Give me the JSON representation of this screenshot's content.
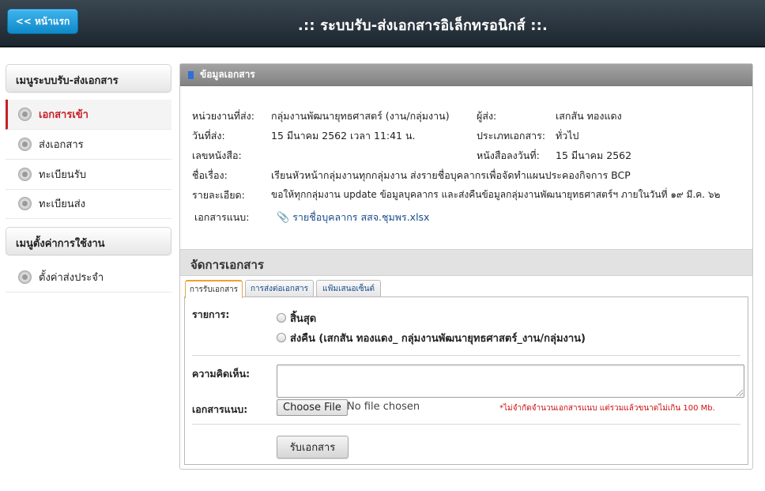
{
  "header": {
    "home_label": "<< หน้าแรก",
    "title": ".:: ระบบรับ-ส่งเอกสารอิเล็กทรอนิกส์ ::."
  },
  "sidebar": {
    "menu1_title": "เมนูระบบรับ-ส่งเอกสาร",
    "menu1_items": [
      {
        "label": "เอกสารเข้า",
        "active": true
      },
      {
        "label": "ส่งเอกสาร",
        "active": false
      },
      {
        "label": "ทะเบียนรับ",
        "active": false
      },
      {
        "label": "ทะเบียนส่ง",
        "active": false
      }
    ],
    "menu2_title": "เมนูตั้งค่าการใช้งาน",
    "menu2_items": [
      {
        "label": "ตั้งค่าส่งประจำ",
        "active": false
      }
    ]
  },
  "doc_info": {
    "section_title": "ข้อมูลเอกสาร",
    "sender_unit_label": "หน่วยงานที่ส่ง:",
    "sender_unit": "กลุ่มงานพัฒนายุทธศาสตร์ (งาน/กลุ่มงาน)",
    "sender_label": "ผู้ส่ง:",
    "sender": "เสกสัน ทองแดง",
    "sent_date_label": "วันที่ส่ง:",
    "sent_date": "15 มีนาคม 2562 เวลา 11:41 น.",
    "doc_type_label": "ประเภทเอกสาร:",
    "doc_type": "ทั่วไป",
    "doc_no_label": "เลขหนังสือ:",
    "doc_no": "",
    "doc_date_label": "หนังสือลงวันที่:",
    "doc_date": "15 มีนาคม 2562",
    "subject_label": "ชื่อเรื่อง:",
    "subject": "เรียนหัวหน้ากลุ่มงานทุกกลุ่มงาน ส่งรายชื่อบุคลากรเพื่อจัดทำแผนประคองกิจการ BCP",
    "detail_label": "รายละเอียด:",
    "detail": "ขอให้ทุกกลุ่มงาน update ข้อมูลบุคลากร และส่งคืนข้อมูลกลุ่มงานพัฒนายุทธศาสตร์ฯ ภายในวันที่ ๑๙ มี.ค. ๖๒",
    "attachment_label": "เอกสารแนบ:",
    "attachment": "รายชื่อบุคลากร สสจ.ชุมพร.xlsx"
  },
  "manage": {
    "title": "จัดการเอกสาร",
    "tabs": [
      {
        "label": "การรับเอกสาร",
        "active": true
      },
      {
        "label": "การส่งต่อเอกสาร",
        "active": false
      },
      {
        "label": "แฟ้มเสนอเซ็นต์",
        "active": false
      }
    ],
    "items_label": "รายการ:",
    "options": [
      "สิ้นสุด",
      "ส่งคืน (เสกสัน ทองแดง_ กลุ่มงานพัฒนายุทธศาสตร์_งาน/กลุ่มงาน)"
    ],
    "comment_label": "ความคิดเห็น:",
    "attach_label": "เอกสารแนบ:",
    "choose_file": "Choose File",
    "no_file": "No file chosen",
    "note": "*ไม่จำกัดจำนวนเอกสารแนบ แต่รวมแล้วขนาดไม่เกิน 100 Mb.",
    "submit": "รับเอกสาร"
  }
}
